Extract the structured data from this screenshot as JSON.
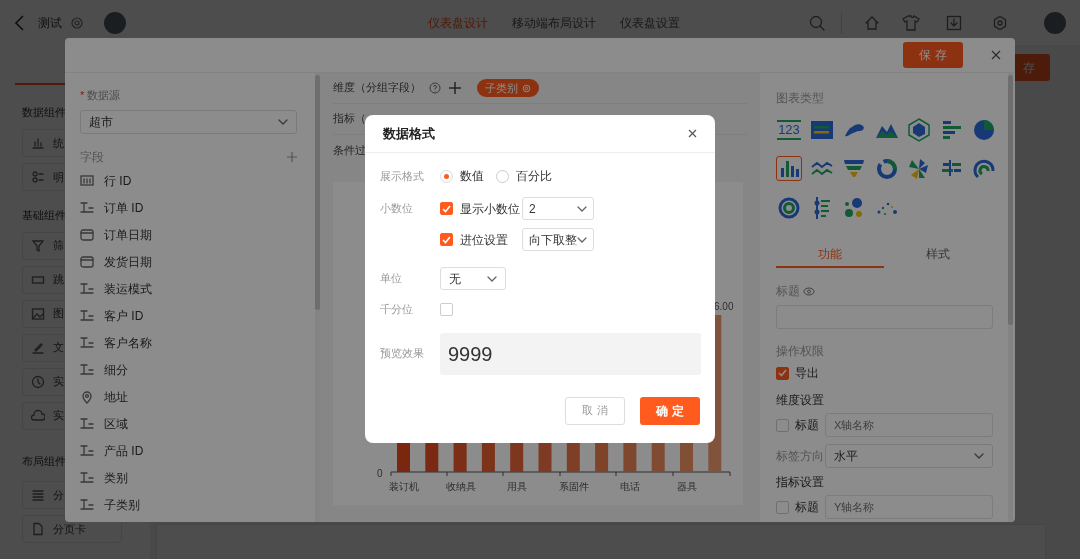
{
  "top_bar": {
    "title": "测试",
    "tabs": [
      {
        "label": "仪表盘设计",
        "selected": true
      },
      {
        "label": "移动端布局设计",
        "selected": false
      },
      {
        "label": "仪表盘设置",
        "selected": false
      }
    ]
  },
  "sidebar": {
    "sections": [
      {
        "title": "数据组件",
        "items": [
          {
            "label": "统",
            "kind": "stats"
          },
          {
            "label": "明",
            "kind": "detail"
          }
        ]
      },
      {
        "title": "基础组件",
        "items": [
          {
            "label": "筛",
            "kind": "filter"
          },
          {
            "label": "跳",
            "kind": "jump"
          },
          {
            "label": "图",
            "kind": "image"
          },
          {
            "label": "文",
            "kind": "text"
          },
          {
            "label": "实",
            "kind": "clock"
          },
          {
            "label": "实",
            "kind": "cloud"
          }
        ]
      },
      {
        "title": "布局组件",
        "items": [
          {
            "label": "分",
            "kind": "group"
          },
          {
            "label": "分页卡",
            "kind": "page"
          }
        ]
      }
    ]
  },
  "page_save_button": "存",
  "editor": {
    "save_button": "保 存",
    "data_source": {
      "required_mark": "*",
      "label": "数据源",
      "value": "超市"
    },
    "fields_title": "字段",
    "fields": [
      {
        "name": "行 ID",
        "kind": "number"
      },
      {
        "name": "订单 ID",
        "kind": "text"
      },
      {
        "name": "订单日期",
        "kind": "date"
      },
      {
        "name": "发货日期",
        "kind": "date"
      },
      {
        "name": "装运模式",
        "kind": "text"
      },
      {
        "name": "客户 ID",
        "kind": "text"
      },
      {
        "name": "客户名称",
        "kind": "text"
      },
      {
        "name": "细分",
        "kind": "text"
      },
      {
        "name": "地址",
        "kind": "geo"
      },
      {
        "name": "区域",
        "kind": "text"
      },
      {
        "name": "产品 ID",
        "kind": "text"
      },
      {
        "name": "类别",
        "kind": "text"
      },
      {
        "name": "子类别",
        "kind": "text"
      }
    ],
    "dimension": {
      "label": "维度（分组字段）",
      "tags": [
        "子类别"
      ]
    },
    "metric_label": "指标（",
    "filter_label": "条件过",
    "chart": {
      "zero_label": "0",
      "value_label": "6.00",
      "categories": [
        "装订机",
        "收纳具",
        "用具",
        "系固件",
        "电话",
        "器具"
      ]
    },
    "config": {
      "chart_type_title": "图表类型",
      "chart_types": [
        {
          "kind": "number",
          "label": "123",
          "selected": false
        },
        {
          "kind": "table",
          "selected": false
        },
        {
          "kind": "map",
          "selected": false
        },
        {
          "kind": "area",
          "selected": false
        },
        {
          "kind": "radar",
          "selected": false
        },
        {
          "kind": "bar",
          "selected": false
        },
        {
          "kind": "pie",
          "selected": false
        },
        {
          "kind": "column",
          "selected": true
        },
        {
          "kind": "line",
          "selected": false
        },
        {
          "kind": "funnel",
          "selected": false
        },
        {
          "kind": "ring",
          "selected": false
        },
        {
          "kind": "rose",
          "selected": false
        },
        {
          "kind": "stacked",
          "selected": false
        },
        {
          "kind": "gauge",
          "selected": false
        },
        {
          "kind": "sunburst",
          "selected": false
        },
        {
          "kind": "timeline",
          "selected": false
        },
        {
          "kind": "bubble",
          "selected": false
        },
        {
          "kind": "scatter",
          "selected": false
        }
      ],
      "tabs": [
        {
          "label": "功能",
          "selected": true
        },
        {
          "label": "样式",
          "selected": false
        }
      ],
      "title_label": "标题",
      "permission_label": "操作权限",
      "permissions": [
        {
          "label": "导出",
          "checked": true
        }
      ],
      "dimension_settings": {
        "title": "维度设置",
        "axis_title": {
          "label": "标题",
          "checked": false,
          "placeholder": "X轴名称"
        },
        "label_direction": {
          "label": "标签方向",
          "value": "水平"
        }
      },
      "metric_settings": {
        "title": "指标设置",
        "axis_title": {
          "label": "标题",
          "checked": false,
          "placeholder": "Y轴名称"
        }
      }
    }
  },
  "dialog": {
    "title": "数据格式",
    "display_format": {
      "label": "展示格式",
      "options": [
        {
          "label": "数值",
          "selected": true
        },
        {
          "label": "百分比",
          "selected": false
        }
      ]
    },
    "decimals": {
      "label": "小数位",
      "rows": [
        {
          "label": "显示小数位",
          "checked": true,
          "value": "2"
        },
        {
          "label": "进位设置",
          "checked": true,
          "value": "向下取整"
        }
      ]
    },
    "unit": {
      "label": "单位",
      "value": "无"
    },
    "thousands": {
      "label": "千分位",
      "checked": false
    },
    "preview": {
      "label": "预览效果",
      "value": "9999"
    },
    "buttons": [
      {
        "label": "取 消",
        "kind": "secondary"
      },
      {
        "label": "确 定",
        "kind": "primary"
      }
    ]
  }
}
